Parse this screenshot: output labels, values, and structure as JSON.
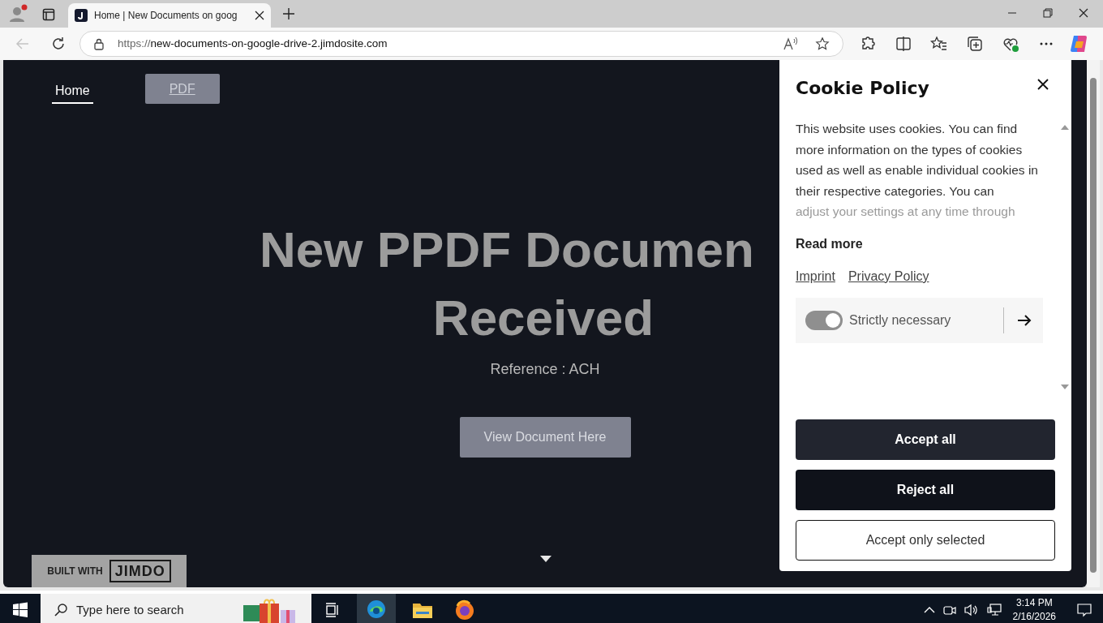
{
  "browser": {
    "tab": {
      "title": "Home | New Documents on goog",
      "selected": true
    },
    "url_scheme": "https://",
    "url_host": "new-documents-on-google-drive-2.jimdosite.com"
  },
  "site": {
    "nav": [
      {
        "label": "Home",
        "kind": "link",
        "selected": true
      },
      {
        "label": "PDF",
        "kind": "button",
        "selected": false
      }
    ],
    "heading_lines": [
      "New PPDF Documen",
      "Received"
    ],
    "reference": "Reference : ACH",
    "cta": "View Document Here",
    "badge": {
      "prefix": "BUILT WITH",
      "brand": "JIMDO"
    }
  },
  "cookie_panel": {
    "title": "Cookie Policy",
    "description": "This website uses cookies. You can find more information on the types of cookies used as well as enable individual cookies in their respective categories. You can",
    "faded_line": "adjust your settings at any time through",
    "read_more": "Read more",
    "links": [
      "Imprint",
      "Privacy Policy"
    ],
    "categories": [
      {
        "label": "Strictly necessary",
        "on": true,
        "disabled": true
      }
    ],
    "buttons": [
      {
        "label": "Accept all",
        "kind": "primary"
      },
      {
        "label": "Reject all",
        "kind": "dark"
      },
      {
        "label": "Accept only selected",
        "kind": "outline"
      }
    ]
  },
  "taskbar": {
    "search_placeholder": "Type here to search",
    "time": "3:14 PM",
    "date": "2/16/2026"
  }
}
